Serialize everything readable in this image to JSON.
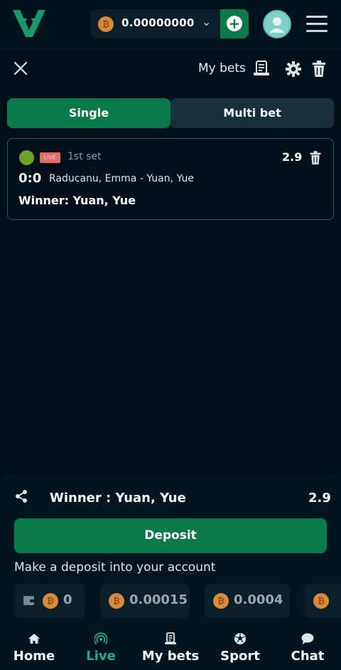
{
  "header": {
    "balance": "0.00000000",
    "coin_symbol": "₿"
  },
  "betslip_bar": {
    "my_bets_label": "My bets"
  },
  "tabs": [
    {
      "label": "Single",
      "active": true
    },
    {
      "label": "Multi bet",
      "active": false
    }
  ],
  "bet": {
    "live_badge": "LIVE",
    "period": "1st set",
    "odds": "2.9",
    "score": "0:0",
    "match": "Raducanu, Emma - Yuan, Yue",
    "selection": "Winner: Yuan, Yue"
  },
  "slip": {
    "title": "Winner : Yuan, Yue",
    "odds": "2.9",
    "deposit_label": "Deposit",
    "deposit_note": "Make a deposit into your account",
    "amounts": [
      "0",
      "0.00015",
      "0.0004"
    ]
  },
  "nav": [
    {
      "label": "Home",
      "icon": "home-icon"
    },
    {
      "label": "Live",
      "icon": "live-icon",
      "active": true
    },
    {
      "label": "My bets",
      "icon": "ticket-icon"
    },
    {
      "label": "Sport",
      "icon": "ball-icon"
    },
    {
      "label": "Chat",
      "icon": "chat-icon"
    }
  ],
  "colors": {
    "accent": "#0b7a4b",
    "live": "#1fae8a",
    "background": "#021019"
  }
}
